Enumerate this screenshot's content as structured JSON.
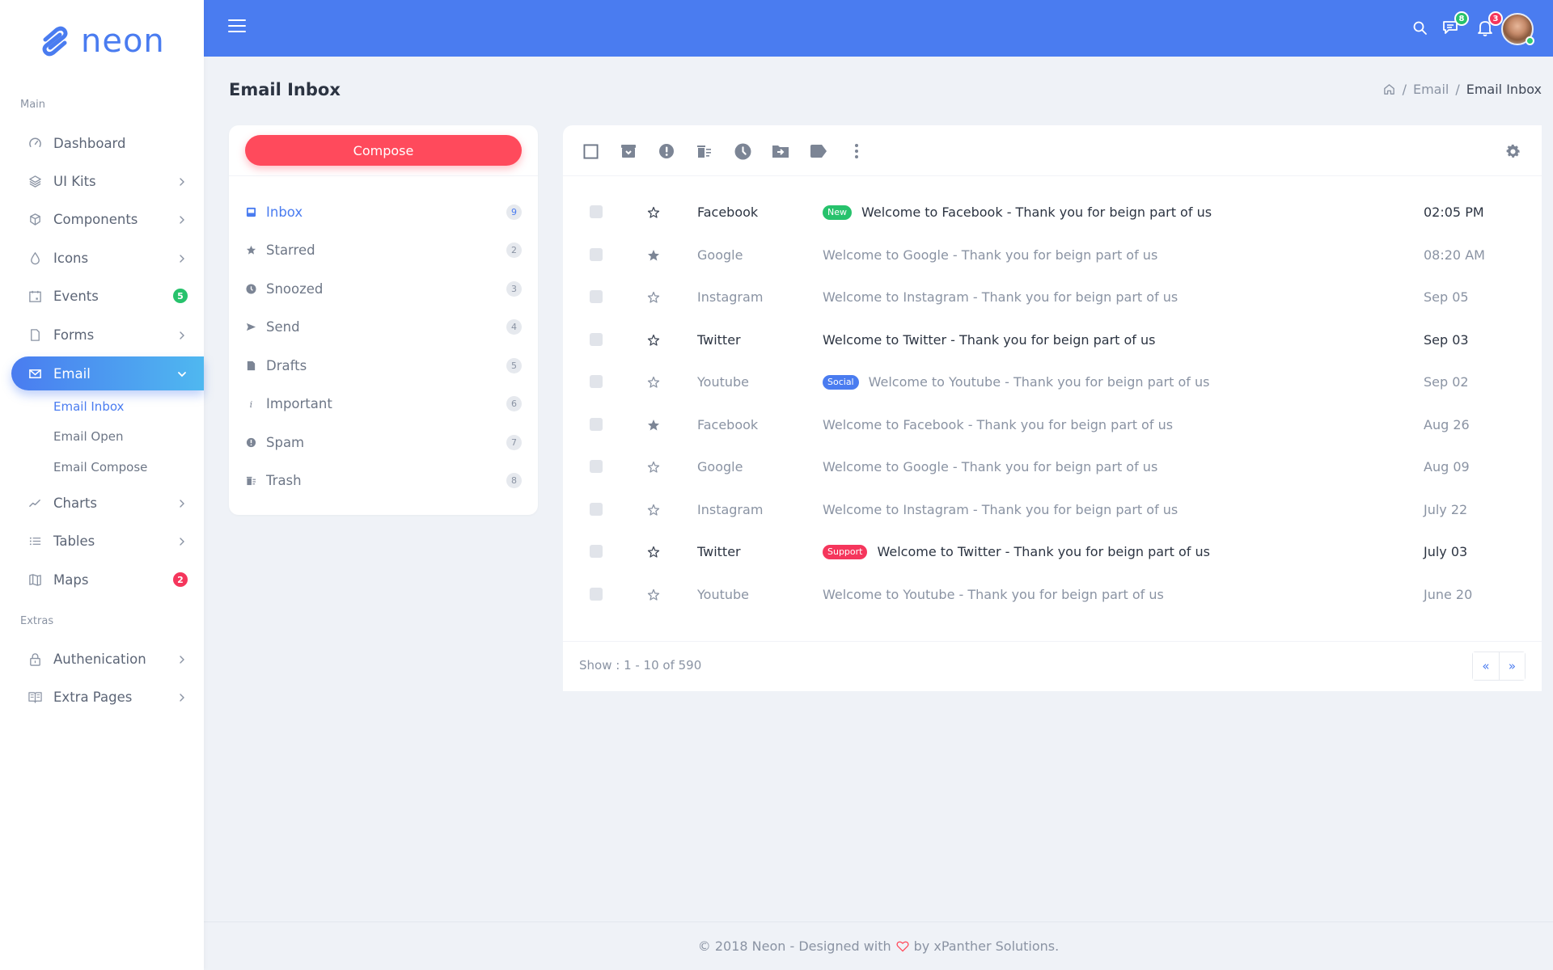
{
  "brand": {
    "name": "neon",
    "color": "#4a7cf0"
  },
  "sidebar": {
    "section_main": "Main",
    "section_extras": "Extras",
    "items": [
      {
        "label": "Dashboard",
        "icon": "dashboard-icon",
        "chevron": false
      },
      {
        "label": "UI Kits",
        "icon": "layers-icon",
        "chevron": true
      },
      {
        "label": "Components",
        "icon": "components-icon",
        "chevron": true
      },
      {
        "label": "Icons",
        "icon": "droplet-icon",
        "chevron": true
      },
      {
        "label": "Events",
        "icon": "calendar-icon",
        "badge": "5",
        "badge_color": "#27c26c"
      },
      {
        "label": "Forms",
        "icon": "file-icon",
        "chevron": true
      },
      {
        "label": "Email",
        "icon": "mail-icon",
        "chevron": true,
        "active": true,
        "expanded": true
      },
      {
        "label": "Charts",
        "icon": "line-chart-icon",
        "chevron": true
      },
      {
        "label": "Tables",
        "icon": "list-icon",
        "chevron": true
      },
      {
        "label": "Maps",
        "icon": "map-icon",
        "badge": "2",
        "badge_color": "#f5365c"
      },
      {
        "label": "Authenication",
        "icon": "lock-icon",
        "chevron": true
      },
      {
        "label": "Extra Pages",
        "icon": "book-icon",
        "chevron": true
      }
    ],
    "email_submenu": [
      {
        "label": "Email Inbox",
        "active": true
      },
      {
        "label": "Email Open"
      },
      {
        "label": "Email Compose"
      }
    ]
  },
  "header": {
    "messages_badge": "8",
    "messages_badge_color": "#27c26c",
    "notifications_badge": "3",
    "notifications_badge_color": "#f5365c"
  },
  "page": {
    "title": "Email Inbox",
    "breadcrumb": [
      "Email",
      "Email Inbox"
    ]
  },
  "folders": {
    "compose_label": "Compose",
    "items": [
      {
        "label": "Inbox",
        "count": "9",
        "icon": "inbox-icon",
        "active": true
      },
      {
        "label": "Starred",
        "count": "2",
        "icon": "star-icon"
      },
      {
        "label": "Snoozed",
        "count": "3",
        "icon": "clock-icon"
      },
      {
        "label": "Send",
        "count": "4",
        "icon": "send-icon"
      },
      {
        "label": "Drafts",
        "count": "5",
        "icon": "draft-icon"
      },
      {
        "label": "Important",
        "count": "6",
        "icon": "info-icon"
      },
      {
        "label": "Spam",
        "count": "7",
        "icon": "spam-icon"
      },
      {
        "label": "Trash",
        "count": "8",
        "icon": "trash-icon"
      }
    ]
  },
  "mail": {
    "rows": [
      {
        "sender": "Facebook",
        "subject": "Welcome to Facebook - Thank you for beign part of us",
        "date": "02:05 PM",
        "unread": true,
        "starred": false,
        "tag": "New",
        "tag_color": "#27c26c"
      },
      {
        "sender": "Google",
        "subject": "Welcome to Google - Thank you for beign part of us",
        "date": "08:20 AM",
        "unread": false,
        "starred": true
      },
      {
        "sender": "Instagram",
        "subject": "Welcome to Instagram - Thank you for beign part of us",
        "date": "Sep 05",
        "unread": false,
        "starred": false
      },
      {
        "sender": "Twitter",
        "subject": "Welcome to Twitter - Thank you for beign part of us",
        "date": "Sep 03",
        "unread": true,
        "starred": false
      },
      {
        "sender": "Youtube",
        "subject": "Welcome to Youtube - Thank you for beign part of us",
        "date": "Sep 02",
        "unread": false,
        "starred": false,
        "tag": "Social",
        "tag_color": "#4a7cf0"
      },
      {
        "sender": "Facebook",
        "subject": "Welcome to Facebook - Thank you for beign part of us",
        "date": "Aug 26",
        "unread": false,
        "starred": true
      },
      {
        "sender": "Google",
        "subject": "Welcome to Google - Thank you for beign part of us",
        "date": "Aug 09",
        "unread": false,
        "starred": false
      },
      {
        "sender": "Instagram",
        "subject": "Welcome to Instagram - Thank you for beign part of us",
        "date": "July 22",
        "unread": false,
        "starred": false
      },
      {
        "sender": "Twitter",
        "subject": "Welcome to Twitter - Thank you for beign part of us",
        "date": "July 03",
        "unread": true,
        "starred": false,
        "tag": "Support",
        "tag_color": "#f5365c"
      },
      {
        "sender": "Youtube",
        "subject": "Welcome to Youtube - Thank you for beign part of us",
        "date": "June 20",
        "unread": false,
        "starred": false
      }
    ],
    "show_text": "Show : 1 - 10 of 590",
    "prev_label": "«",
    "next_label": "»"
  },
  "footer": {
    "before": "© 2018 Neon - Designed with",
    "after": "by xPanther Solutions."
  }
}
